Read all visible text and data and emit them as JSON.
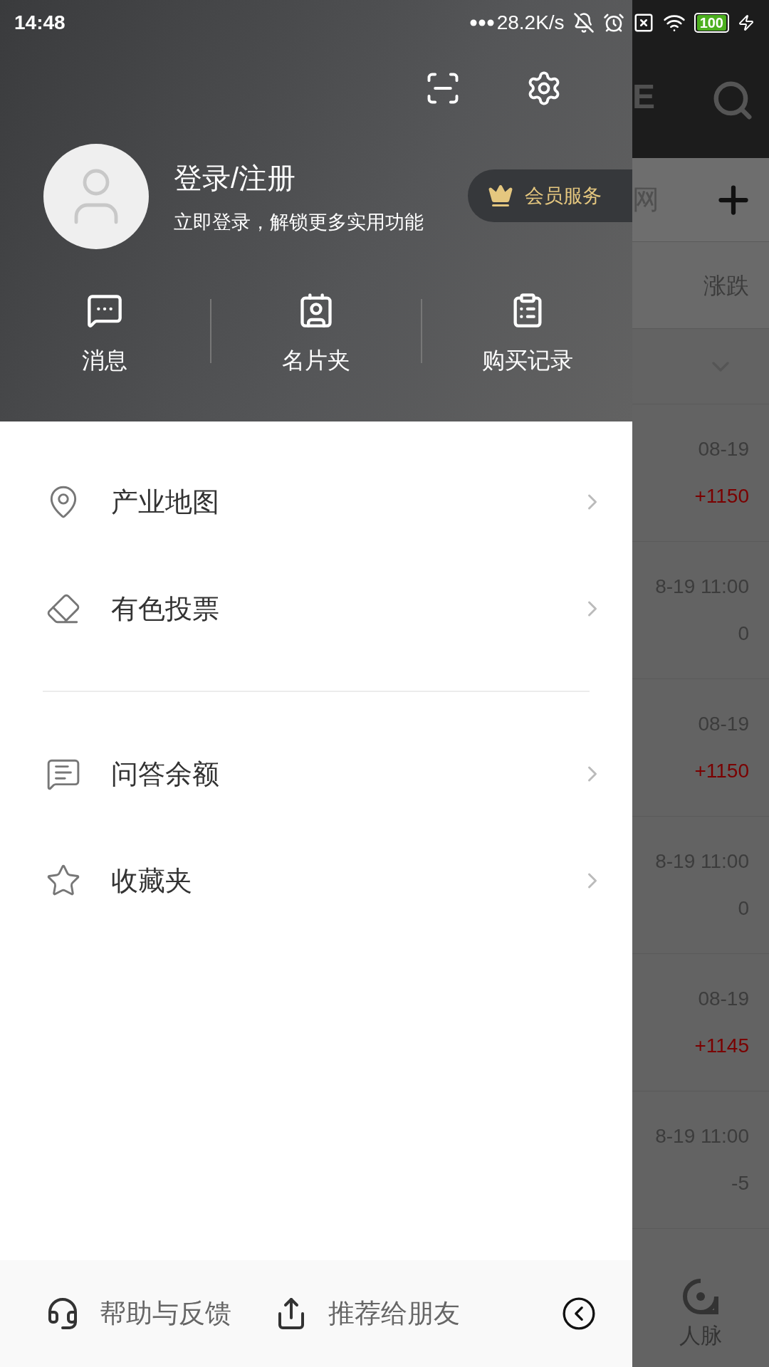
{
  "status_bar": {
    "time": "14:48",
    "network_speed": "28.2K/s",
    "battery": "100"
  },
  "background_page": {
    "header_text": "E",
    "tab_text": "网",
    "column_header": "涨跌",
    "rows": [
      {
        "time": "08-19",
        "change": "+1150",
        "color": "#7a0000"
      },
      {
        "time": "8-19 11:00",
        "change": "0",
        "color": "#3c3c3c"
      },
      {
        "time": "08-19",
        "change": "+1150",
        "color": "#7a0000"
      },
      {
        "time": "8-19 11:00",
        "change": "0",
        "color": "#3c3c3c"
      },
      {
        "time": "08-19",
        "change": "+1145",
        "color": "#7a0000"
      },
      {
        "time": "8-19 11:00",
        "change": "-5",
        "color": "#3c3c3c"
      }
    ],
    "nav_label": "人脉"
  },
  "drawer": {
    "profile": {
      "title": "登录/注册",
      "subtitle": "立即登录，解锁更多实用功能",
      "member_button": "会员服务"
    },
    "shortcuts": [
      {
        "label": "消息"
      },
      {
        "label": "名片夹"
      },
      {
        "label": "购买记录"
      }
    ],
    "menu_sections": [
      {
        "items": [
          {
            "label": "产业地图"
          },
          {
            "label": "有色投票"
          }
        ]
      },
      {
        "items": [
          {
            "label": "问答余额"
          },
          {
            "label": "收藏夹"
          }
        ]
      }
    ],
    "footer": [
      {
        "label": "帮助与反馈"
      },
      {
        "label": "推荐给朋友"
      }
    ]
  }
}
